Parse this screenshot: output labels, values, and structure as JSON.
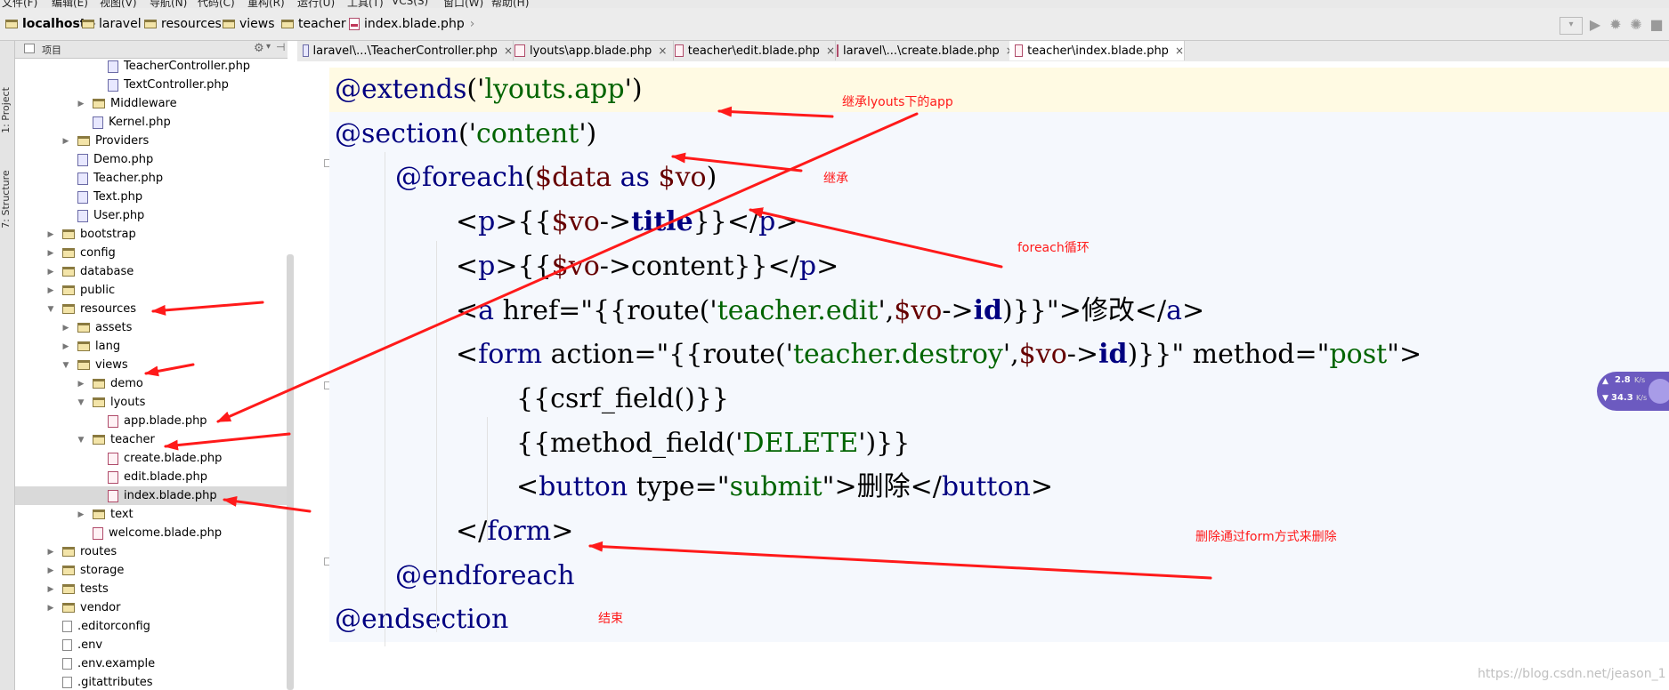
{
  "menu": [
    "文件(F)",
    "编辑(E)",
    "视图(V)",
    "导航(N)",
    "代码(C)",
    "重构(R)",
    "运行(U)",
    "工具(T)",
    "VCS(S)",
    "窗口(W)",
    "帮助(H)"
  ],
  "breadcrumb": [
    "localhost",
    "laravel",
    "resources",
    "views",
    "teacher",
    "index.blade.php"
  ],
  "left_strip": {
    "project_tab": "1: Project",
    "structure_tab": "7: Structure"
  },
  "project_panel": {
    "title": "项目"
  },
  "tree": [
    {
      "label": "TeacherController.php",
      "type": "php",
      "depth": 6
    },
    {
      "label": "TextController.php",
      "type": "php",
      "depth": 6
    },
    {
      "label": "Middleware",
      "type": "folder",
      "depth": 5,
      "state": "collapsed"
    },
    {
      "label": "Kernel.php",
      "type": "php",
      "depth": 5
    },
    {
      "label": "Providers",
      "type": "folder",
      "depth": 4,
      "state": "collapsed"
    },
    {
      "label": "Demo.php",
      "type": "php",
      "depth": 4
    },
    {
      "label": "Teacher.php",
      "type": "php",
      "depth": 4
    },
    {
      "label": "Text.php",
      "type": "php",
      "depth": 4
    },
    {
      "label": "User.php",
      "type": "php",
      "depth": 4
    },
    {
      "label": "bootstrap",
      "type": "folder",
      "depth": 3,
      "state": "collapsed"
    },
    {
      "label": "config",
      "type": "folder",
      "depth": 3,
      "state": "collapsed"
    },
    {
      "label": "database",
      "type": "folder",
      "depth": 3,
      "state": "collapsed"
    },
    {
      "label": "public",
      "type": "folder",
      "depth": 3,
      "state": "collapsed"
    },
    {
      "label": "resources",
      "type": "folder",
      "depth": 3,
      "state": "expanded"
    },
    {
      "label": "assets",
      "type": "folder",
      "depth": 4,
      "state": "collapsed"
    },
    {
      "label": "lang",
      "type": "folder",
      "depth": 4,
      "state": "collapsed"
    },
    {
      "label": "views",
      "type": "folder",
      "depth": 4,
      "state": "expanded"
    },
    {
      "label": "demo",
      "type": "folder",
      "depth": 5,
      "state": "collapsed"
    },
    {
      "label": "lyouts",
      "type": "folder",
      "depth": 5,
      "state": "expanded"
    },
    {
      "label": "app.blade.php",
      "type": "blade",
      "depth": 6
    },
    {
      "label": "teacher",
      "type": "folder",
      "depth": 5,
      "state": "expanded"
    },
    {
      "label": "create.blade.php",
      "type": "blade",
      "depth": 6
    },
    {
      "label": "edit.blade.php",
      "type": "blade",
      "depth": 6
    },
    {
      "label": "index.blade.php",
      "type": "blade",
      "depth": 6,
      "selected": true
    },
    {
      "label": "text",
      "type": "folder",
      "depth": 5,
      "state": "collapsed"
    },
    {
      "label": "welcome.blade.php",
      "type": "blade",
      "depth": 5
    },
    {
      "label": "routes",
      "type": "folder",
      "depth": 3,
      "state": "collapsed"
    },
    {
      "label": "storage",
      "type": "folder",
      "depth": 3,
      "state": "collapsed"
    },
    {
      "label": "tests",
      "type": "folder",
      "depth": 3,
      "state": "collapsed"
    },
    {
      "label": "vendor",
      "type": "folder",
      "depth": 3,
      "state": "collapsed"
    },
    {
      "label": ".editorconfig",
      "type": "file",
      "depth": 3
    },
    {
      "label": ".env",
      "type": "file",
      "depth": 3
    },
    {
      "label": ".env.example",
      "type": "file",
      "depth": 3
    },
    {
      "label": ".gitattributes",
      "type": "file",
      "depth": 3
    }
  ],
  "tabs": [
    {
      "label": "laravel\\...\\TeacherController.php",
      "icon": "php"
    },
    {
      "label": "lyouts\\app.blade.php",
      "icon": "blade"
    },
    {
      "label": "teacher\\edit.blade.php",
      "icon": "blade"
    },
    {
      "label": "laravel\\...\\create.blade.php",
      "icon": "blade"
    },
    {
      "label": "teacher\\index.blade.php",
      "icon": "blade",
      "active": true
    }
  ],
  "code": [
    {
      "indent": 0,
      "tokens": [
        [
          "tag",
          "@extends"
        ],
        [
          "plain",
          "('"
        ],
        [
          "str",
          "lyouts.app"
        ],
        [
          "plain",
          "')"
        ]
      ],
      "highlight": true
    },
    {
      "indent": 0,
      "tokens": [
        [
          "tag",
          "@section"
        ],
        [
          "plain",
          "('"
        ],
        [
          "str",
          "content"
        ],
        [
          "plain",
          "')"
        ]
      ]
    },
    {
      "indent": 1,
      "tokens": [
        [
          "tag",
          "@foreach"
        ],
        [
          "plain",
          "("
        ],
        [
          "var",
          "$data"
        ],
        [
          "plain",
          " "
        ],
        [
          "tag",
          "as"
        ],
        [
          "plain",
          " "
        ],
        [
          "var",
          "$vo"
        ],
        [
          "plain",
          ")"
        ]
      ]
    },
    {
      "indent": 2,
      "tokens": [
        [
          "plain",
          "<"
        ],
        [
          "tag",
          "p"
        ],
        [
          "plain",
          ">{{"
        ],
        [
          "var",
          "$vo"
        ],
        [
          "plain",
          "->"
        ],
        [
          "bold",
          "title"
        ],
        [
          "plain",
          "}}</"
        ],
        [
          "tag",
          "p"
        ],
        [
          "plain",
          ">"
        ]
      ]
    },
    {
      "indent": 2,
      "tokens": [
        [
          "plain",
          "<"
        ],
        [
          "tag",
          "p"
        ],
        [
          "plain",
          ">{{"
        ],
        [
          "var",
          "$vo"
        ],
        [
          "plain",
          "->content}}</"
        ],
        [
          "tag",
          "p"
        ],
        [
          "plain",
          ">"
        ]
      ]
    },
    {
      "indent": 2,
      "tokens": [
        [
          "plain",
          "<"
        ],
        [
          "tag",
          "a"
        ],
        [
          "plain",
          " href=\"{{route('"
        ],
        [
          "str",
          "teacher.edit"
        ],
        [
          "plain",
          "',"
        ],
        [
          "var",
          "$vo"
        ],
        [
          "plain",
          "->"
        ],
        [
          "bold",
          "id"
        ],
        [
          "plain",
          ")}}\">修改</"
        ],
        [
          "tag",
          "a"
        ],
        [
          "plain",
          ">"
        ]
      ]
    },
    {
      "indent": 2,
      "tokens": [
        [
          "plain",
          "<"
        ],
        [
          "tag",
          "form"
        ],
        [
          "plain",
          " action=\"{{route('"
        ],
        [
          "str",
          "teacher.destroy"
        ],
        [
          "plain",
          "',"
        ],
        [
          "var",
          "$vo"
        ],
        [
          "plain",
          "->"
        ],
        [
          "bold",
          "id"
        ],
        [
          "plain",
          ")}}\" method=\""
        ],
        [
          "str",
          "post"
        ],
        [
          "plain",
          "\">"
        ]
      ]
    },
    {
      "indent": 3,
      "tokens": [
        [
          "plain",
          "{{csrf_field()}}"
        ]
      ]
    },
    {
      "indent": 3,
      "tokens": [
        [
          "plain",
          "{{method_field('"
        ],
        [
          "str",
          "DELETE"
        ],
        [
          "plain",
          "')}}"
        ]
      ]
    },
    {
      "indent": 3,
      "tokens": [
        [
          "plain",
          "<"
        ],
        [
          "tag",
          "button"
        ],
        [
          "plain",
          " type=\""
        ],
        [
          "str",
          "submit"
        ],
        [
          "plain",
          "\">删除</"
        ],
        [
          "tag",
          "button"
        ],
        [
          "plain",
          ">"
        ]
      ]
    },
    {
      "indent": 2,
      "tokens": [
        [
          "plain",
          "</"
        ],
        [
          "tag",
          "form"
        ],
        [
          "plain",
          ">"
        ]
      ]
    },
    {
      "indent": 1,
      "tokens": [
        [
          "tag",
          "@endforeach"
        ]
      ]
    },
    {
      "indent": 0,
      "tokens": [
        [
          "tag",
          "@endsection"
        ]
      ]
    }
  ],
  "annotations": [
    {
      "text": "继承lyouts下的app"
    },
    {
      "text": "继承"
    },
    {
      "text": "foreach循环"
    },
    {
      "text": "删除通过form方式来删除"
    },
    {
      "text": "结束"
    }
  ],
  "net_widget": {
    "up": "2.8",
    "up_unit": "K/s",
    "down": "34.3",
    "down_unit": "K/s"
  },
  "watermark": "https://blog.csdn.net/jeason_1",
  "colors": {
    "annotation": "#ff1a1a",
    "tag": "#000080",
    "string": "#006400",
    "variable": "#660000",
    "highlight_line": "#fffae3"
  }
}
